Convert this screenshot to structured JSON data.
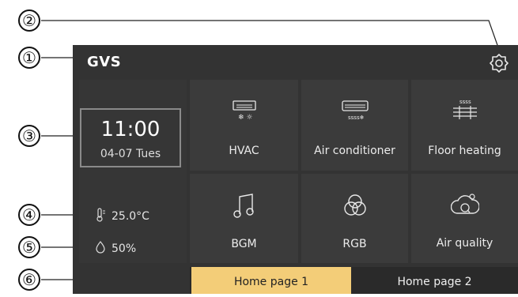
{
  "header": {
    "logo_text": "GVS",
    "settings_icon": "gear-icon"
  },
  "clock": {
    "time": "11:00",
    "date": "04-07  Tues"
  },
  "sensors": {
    "temperature": {
      "value": "25.0°C",
      "icon": "thermometer-icon"
    },
    "humidity": {
      "value": "50%",
      "icon": "droplet-icon"
    }
  },
  "tiles": [
    {
      "label": "HVAC",
      "icon": "hvac-icon"
    },
    {
      "label": "Air conditioner",
      "icon": "air-conditioner-icon"
    },
    {
      "label": "Floor heating",
      "icon": "floor-heating-icon"
    },
    {
      "label": "BGM",
      "icon": "music-note-icon"
    },
    {
      "label": "RGB",
      "icon": "rgb-circles-icon"
    },
    {
      "label": "Air quality",
      "icon": "air-quality-icon"
    }
  ],
  "tabs": [
    {
      "label": "Home page 1",
      "active": true
    },
    {
      "label": "Home page 2",
      "active": false
    }
  ],
  "callouts": [
    "①",
    "②",
    "③",
    "④",
    "⑤",
    "⑥"
  ],
  "colors": {
    "panel": "#333333",
    "tile": "#3b3b3b",
    "active_tab": "#f3cd78"
  }
}
